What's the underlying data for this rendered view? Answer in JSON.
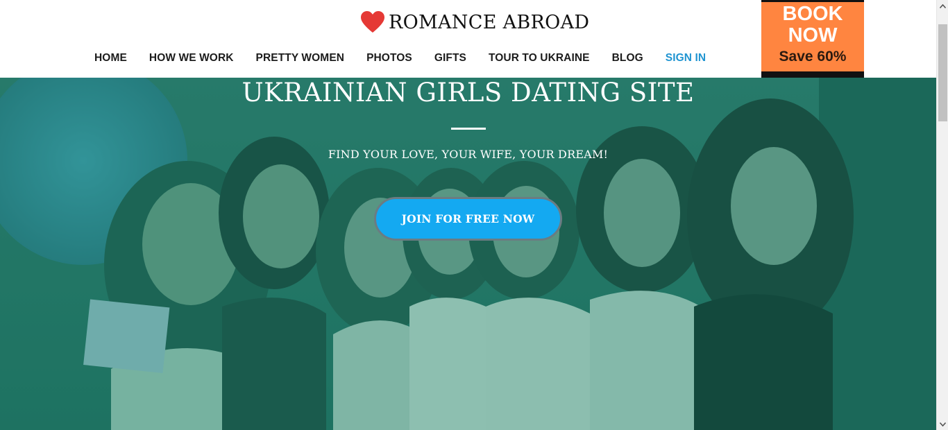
{
  "header": {
    "logo": {
      "icon": "heart-icon",
      "text": "ROMANCE ABROAD",
      "heart_color": "#e53935"
    },
    "nav": [
      {
        "id": "home",
        "label": "HOME"
      },
      {
        "id": "how-we-work",
        "label": "HOW WE WORK"
      },
      {
        "id": "pretty-women",
        "label": "PRETTY WOMEN"
      },
      {
        "id": "photos",
        "label": "PHOTOS"
      },
      {
        "id": "gifts",
        "label": "GIFTS"
      },
      {
        "id": "tour-to-ukraine",
        "label": "TOUR TO UKRAINE"
      },
      {
        "id": "blog",
        "label": "BLOG"
      },
      {
        "id": "sign-in",
        "label": "SIGN IN"
      }
    ],
    "promo": {
      "line1": "BOOK",
      "line2": "NOW",
      "save": "Save 60%",
      "background": "#ff8540"
    }
  },
  "hero": {
    "title": "UKRAINIAN GIRLS DATING SITE",
    "subtitle": "FIND YOUR LOVE, YOUR WIFE, YOUR DREAM!",
    "cta": "JOIN FOR FREE NOW",
    "cta_color": "#14a9f1",
    "overlay_color": "#1e7a68"
  },
  "colors": {
    "nav_text": "#1c1c1c",
    "nav_accent": "#1f94d1"
  }
}
